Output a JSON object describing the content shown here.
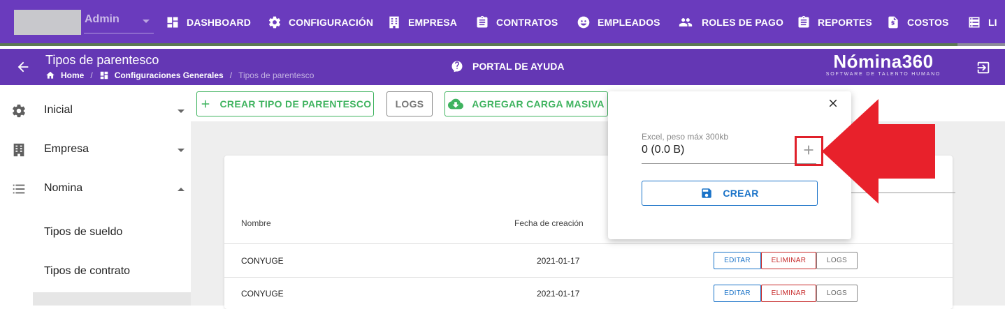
{
  "user": {
    "name": "Admin"
  },
  "topnav": {
    "items": [
      {
        "label": "DASHBOARD",
        "icon": "dashboard-icon"
      },
      {
        "label": "CONFIGURACIÓN",
        "icon": "gear-icon"
      },
      {
        "label": "EMPRESA",
        "icon": "building-icon"
      },
      {
        "label": "CONTRATOS",
        "icon": "clipboard-icon"
      },
      {
        "label": "EMPLEADOS",
        "icon": "face-icon"
      },
      {
        "label": "ROLES DE PAGO",
        "icon": "people-icon"
      },
      {
        "label": "REPORTES",
        "icon": "clipboard-icon"
      },
      {
        "label": "COSTOS",
        "icon": "invoice-icon"
      },
      {
        "label": "LI",
        "icon": "list-icon"
      }
    ]
  },
  "header": {
    "title": "Tipos de parentesco",
    "breadcrumb": [
      "Home",
      "Configuraciones Generales",
      "Tipos de parentesco"
    ],
    "help_label": "PORTAL DE AYUDA",
    "logo_main": "Nómina360",
    "logo_sub": "SOFTWARE DE TALENTO HUMANO"
  },
  "sidebar": {
    "items": [
      {
        "label": "Inicial",
        "icon": "gear-icon",
        "expanded": false
      },
      {
        "label": "Empresa",
        "icon": "building-icon",
        "expanded": false
      },
      {
        "label": "Nomina",
        "icon": "list-icon",
        "expanded": true
      }
    ],
    "subitems": [
      "Tipos de sueldo",
      "Tipos de contrato"
    ]
  },
  "toolbar": {
    "create_label": "CREAR TIPO DE PARENTESCO",
    "logs_label": "LOGS",
    "bulk_label": "AGREGAR CARGA MASIVA"
  },
  "table": {
    "columns": [
      "Nombre",
      "Fecha de creación"
    ],
    "rows": [
      {
        "nombre": "CONYUGE",
        "fecha": "2021-01-17"
      },
      {
        "nombre": "CONYUGE",
        "fecha": "2021-01-17"
      }
    ],
    "actions": {
      "edit": "EDITAR",
      "delete": "ELIMINAR",
      "logs": "LOGS"
    }
  },
  "popup": {
    "file_label": "Excel, peso máx 300kb",
    "file_value": "0 (0.0 B)",
    "create_label": "CREAR"
  },
  "colors": {
    "primary": "#6a3bbd",
    "green": "#3fb35f",
    "blue": "#1a73c8",
    "red": "#e0202a"
  }
}
